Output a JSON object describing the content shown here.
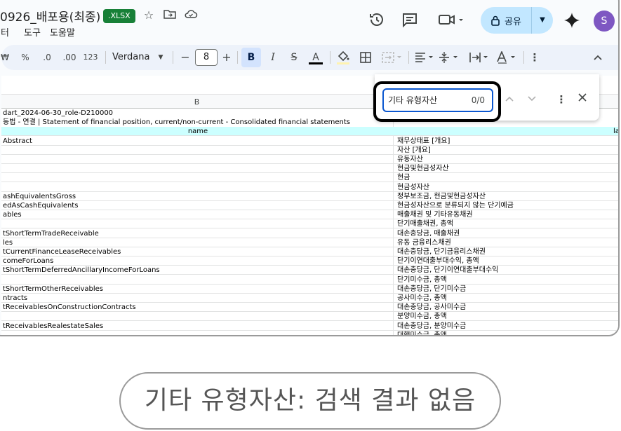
{
  "title": {
    "doc_name": "0926_배포용(최종)",
    "badge": ".XLSX",
    "menu": [
      "터",
      "도구",
      "도움말"
    ],
    "share_label": "공유",
    "avatar_letter": "S"
  },
  "toolbar": {
    "w_label": "₩",
    "percent": "%",
    "dec_less": ".0",
    "dec_more": ".00",
    "format_123": "123",
    "font_name": "Verdana",
    "font_size": "8",
    "bold": "B",
    "italic": "I",
    "strike": "S",
    "text_color": "A"
  },
  "grid": {
    "col_b_header": "B",
    "rows": [
      {
        "b": "dart_2024-06-30_role-D210000",
        "c": ""
      },
      {
        "b": "동법 - 연결 | Statement of financial position, current/non-current - Consolidated financial statements",
        "c": ""
      },
      {
        "b": "name",
        "c": "la",
        "header": true
      },
      {
        "b": "Abstract",
        "c": "재무상태표 [개요]"
      },
      {
        "b": "",
        "c": "자산 [개요]"
      },
      {
        "b": "",
        "c": "유동자산"
      },
      {
        "b": "",
        "c": "현금및현금성자산"
      },
      {
        "b": "",
        "c": "현금"
      },
      {
        "b": "",
        "c": "현금성자산"
      },
      {
        "b": "ashEquivalentsGross",
        "c": "정부보조금, 현금및현금성자산"
      },
      {
        "b": "edAsCashEquivalents",
        "c": "현금성자산으로 분류되지 않는 단기예금"
      },
      {
        "b": "ables",
        "c": "매출채권 및 기타유동채권"
      },
      {
        "b": "",
        "c": "단기매출채권, 총액"
      },
      {
        "b": "tShortTermTradeReceivable",
        "c": "대손충당금, 매출채권"
      },
      {
        "b": "les",
        "c": "유동 금융리스채권"
      },
      {
        "b": "tCurrentFinanceLeaseReceivables",
        "c": "대손충당금, 단기금융리스채권"
      },
      {
        "b": "comeForLoans",
        "c": "단기이연대출부대수익, 총액"
      },
      {
        "b": "tShortTermDeferredAncillaryIncomeForLoans",
        "c": "대손충당금, 단기이연대출부대수익"
      },
      {
        "b": "",
        "c": "단기미수금, 총액"
      },
      {
        "b": "tShortTermOtherReceivables",
        "c": "대손충당금, 단기미수금"
      },
      {
        "b": "ntracts",
        "c": "공사미수금, 총액"
      },
      {
        "b": "tReceivablesOnConstructionContracts",
        "c": "대손충당금, 공사미수금"
      },
      {
        "b": "",
        "c": "분양미수금, 총액"
      },
      {
        "b": "tReceivablesRealestateSales",
        "c": "대손충당금, 분양미수금"
      },
      {
        "b": "",
        "c": "대행미수금, 총액"
      }
    ]
  },
  "find": {
    "query": "기타 유형자산",
    "count": "0/0"
  },
  "caption": "기타 유형자산: 검색 결과 없음"
}
